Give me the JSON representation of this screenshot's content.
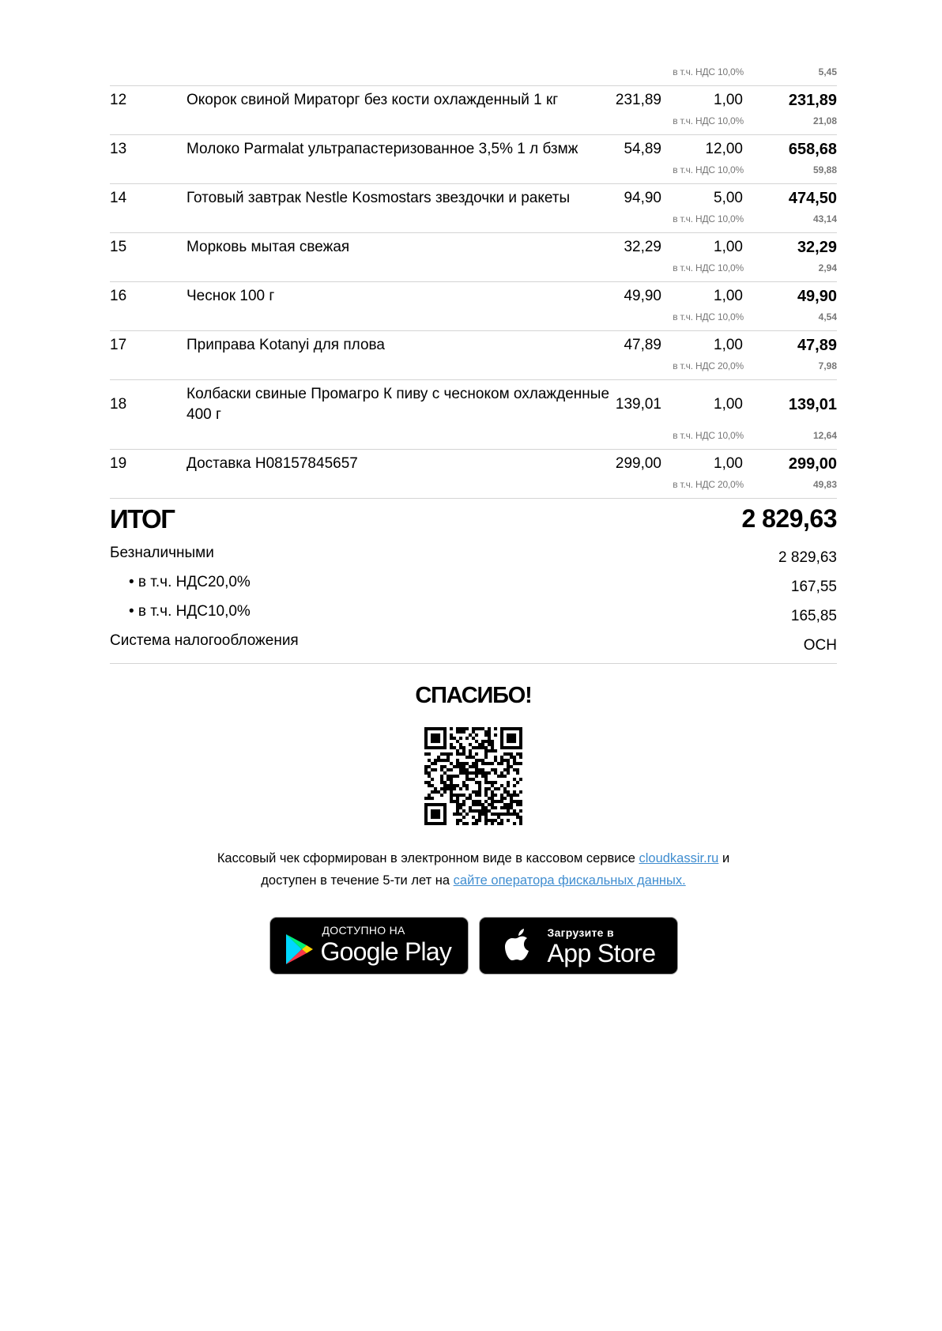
{
  "vat_first": {
    "label": "в т.ч. НДС 10,0%",
    "amount": "5,45"
  },
  "items": [
    {
      "num": "12",
      "name": "Окорок свиной Мираторг без кости охлажденный 1 кг",
      "price": "231,89",
      "qty": "1,00",
      "sum": "231,89",
      "vat_label": "в т.ч. НДС 10,0%",
      "vat_amount": "21,08"
    },
    {
      "num": "13",
      "name": "Молоко Parmalat ультрапастеризованное 3,5% 1 л бзмж",
      "price": "54,89",
      "qty": "12,00",
      "sum": "658,68",
      "vat_label": "в т.ч. НДС 10,0%",
      "vat_amount": "59,88"
    },
    {
      "num": "14",
      "name": "Готовый завтрак Nestle Kosmostars звездочки и ракеты",
      "price": "94,90",
      "qty": "5,00",
      "sum": "474,50",
      "vat_label": "в т.ч. НДС 10,0%",
      "vat_amount": "43,14"
    },
    {
      "num": "15",
      "name": "Морковь мытая свежая",
      "price": "32,29",
      "qty": "1,00",
      "sum": "32,29",
      "vat_label": "в т.ч. НДС 10,0%",
      "vat_amount": "2,94"
    },
    {
      "num": "16",
      "name": "Чеснок 100 г",
      "price": "49,90",
      "qty": "1,00",
      "sum": "49,90",
      "vat_label": "в т.ч. НДС 10,0%",
      "vat_amount": "4,54"
    },
    {
      "num": "17",
      "name": "Приправа Kotanyi для плова",
      "price": "47,89",
      "qty": "1,00",
      "sum": "47,89",
      "vat_label": "в т.ч. НДС 20,0%",
      "vat_amount": "7,98"
    },
    {
      "num": "18",
      "name": "Колбаски свиные Промагро К пиву с чесноком охлажденные 400 г",
      "price": "139,01",
      "qty": "1,00",
      "sum": "139,01",
      "vat_label": "в т.ч. НДС 10,0%",
      "vat_amount": "12,64"
    },
    {
      "num": "19",
      "name": "Доставка Н08157845657",
      "price": "299,00",
      "qty": "1,00",
      "sum": "299,00",
      "vat_label": "в т.ч. НДС 20,0%",
      "vat_amount": "49,83"
    }
  ],
  "total": {
    "label": "ИТОГ",
    "value": "2 829,63"
  },
  "payments": [
    {
      "label": "Безналичными",
      "value": "2 829,63",
      "indent": false
    },
    {
      "label": "• в т.ч. НДС20,0%",
      "value": "167,55",
      "indent": true
    },
    {
      "label": "• в т.ч. НДС10,0%",
      "value": "165,85",
      "indent": true
    },
    {
      "label": "Система налогообложения",
      "value": "ОСН",
      "indent": false
    }
  ],
  "thanks": "СПАСИБО!",
  "footer": {
    "line1_prefix": "Кассовый чек сформирован в электронном виде в кассовом сервисе ",
    "line1_link": "cloudkassir.ru",
    "line1_suffix": " и",
    "line2_prefix": "доступен в течение 5-ти лет на ",
    "line2_link": "сайте оператора фискальных данных."
  },
  "badges": {
    "google": {
      "small": "ДОСТУПНО НА",
      "big": "Google Play"
    },
    "apple": {
      "small": "Загрузите в",
      "big": "App Store"
    }
  },
  "icons": {
    "google": "google-play-logo",
    "apple": "apple-logo",
    "qr": "qr-code"
  }
}
